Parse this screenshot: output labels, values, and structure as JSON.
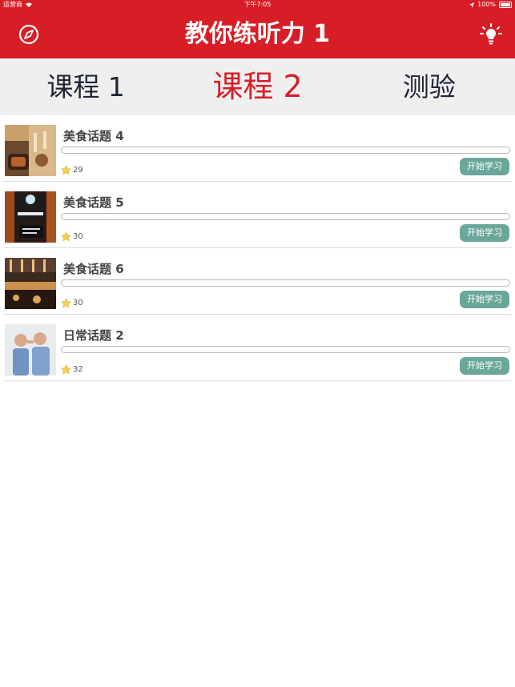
{
  "status_bar": {
    "carrier": "运营商",
    "time": "下午7:05",
    "battery": "100%"
  },
  "header": {
    "title": "教你练听力 1",
    "left_icon": "compass-icon",
    "right_icon": "lightbulb-icon"
  },
  "tabs": [
    {
      "label": "课程 1",
      "active": false
    },
    {
      "label": "课程 2",
      "active": true
    },
    {
      "label": "测验",
      "active": false
    }
  ],
  "lessons": [
    {
      "title": "美食话题 4",
      "stars": "29",
      "button": "开始学习",
      "progress": 0
    },
    {
      "title": "美食话题 5",
      "stars": "30",
      "button": "开始学习",
      "progress": 0
    },
    {
      "title": "美食话题 6",
      "stars": "30",
      "button": "开始学习",
      "progress": 0
    },
    {
      "title": "日常话题 2",
      "stars": "32",
      "button": "开始学习",
      "progress": 0
    }
  ],
  "colors": {
    "brand": "#d71e27",
    "accent": "#6aa79b",
    "tab_bg": "#efefef"
  }
}
